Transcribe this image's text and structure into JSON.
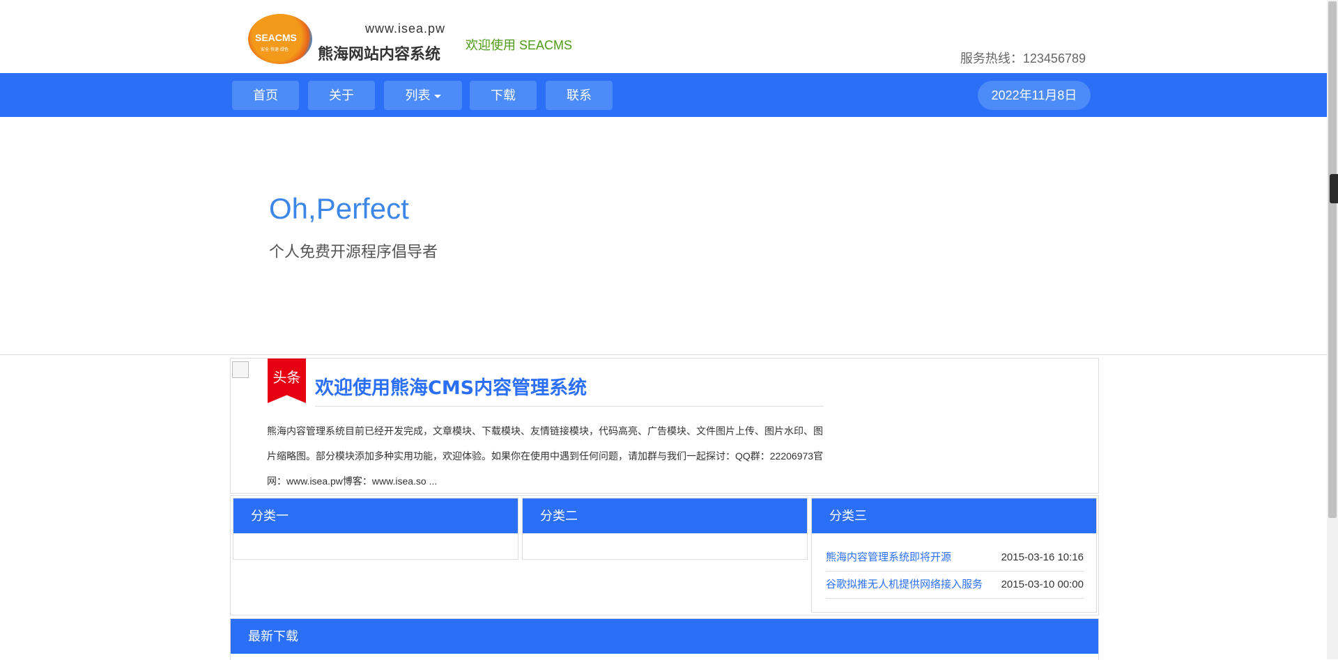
{
  "header": {
    "logo_brand": "SEACMS",
    "logo_slogan": "安全·快速·绿色",
    "logo_url": "www.isea.pw",
    "logo_name": "熊海网站内容系统",
    "welcome": "欢迎使用 SEACMS",
    "hotline": "服务热线：123456789"
  },
  "nav": {
    "items": [
      {
        "label": "首页"
      },
      {
        "label": "关于"
      },
      {
        "label": "列表"
      },
      {
        "label": "下载"
      },
      {
        "label": "联系"
      }
    ],
    "date": "2022年11月8日"
  },
  "hero": {
    "title": "Oh,Perfect",
    "subtitle": "个人免费开源程序倡导者"
  },
  "headline": {
    "badge": "头条",
    "title": "欢迎使用熊海CMS内容管理系统",
    "text": "熊海内容管理系统目前已经开发完成，文章模块、下载模块、友情链接模块，代码高亮、广告模块、文件图片上传、图片水印、图片缩略图。部分模块添加多种实用功能，欢迎体验。如果你在使用中遇到任何问题，请加群与我们一起探讨：QQ群：22206973官网：www.isea.pw博客：www.isea.so ..."
  },
  "categories": [
    {
      "title": "分类一",
      "items": []
    },
    {
      "title": "分类二",
      "items": []
    },
    {
      "title": "分类三",
      "items": [
        {
          "title": "熊海内容管理系统即将开源",
          "date": "2015-03-16 10:16"
        },
        {
          "title": "谷歌拟推无人机提供网络接入服务",
          "date": "2015-03-10 00:00"
        }
      ]
    }
  ],
  "downloads": {
    "title": "最新下载"
  },
  "colors": {
    "primary": "#2b6ff7",
    "nav_button": "#4c8bf8",
    "welcome_green": "#4d9b16",
    "hero_blue": "#3b86e6",
    "ribbon_red": "#e60012"
  }
}
